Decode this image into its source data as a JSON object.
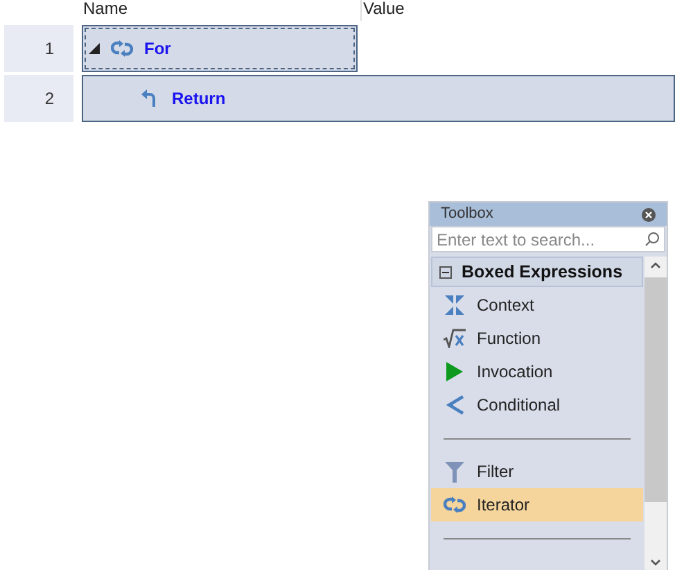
{
  "grid": {
    "columns": [
      "Name",
      "Value"
    ],
    "rows": [
      {
        "number": "1",
        "name": "For",
        "expanded": true,
        "selected": true,
        "kind": "iterator"
      },
      {
        "number": "2",
        "name": "Return",
        "kind": "return"
      }
    ]
  },
  "toolbox": {
    "title": "Toolbox",
    "search": {
      "placeholder": "Enter text to search..."
    },
    "group": {
      "label": "Boxed Expressions",
      "expanded": true
    },
    "items": [
      {
        "kind": "context",
        "label": "Context",
        "selected": false
      },
      {
        "kind": "function",
        "label": "Function",
        "selected": false
      },
      {
        "kind": "invocation",
        "label": "Invocation",
        "selected": false
      },
      {
        "kind": "conditional",
        "label": "Conditional",
        "selected": false
      },
      {
        "kind": "separator"
      },
      {
        "kind": "filter",
        "label": "Filter",
        "selected": false
      },
      {
        "kind": "iterator",
        "label": "Iterator",
        "selected": true
      },
      {
        "kind": "separator"
      }
    ]
  }
}
